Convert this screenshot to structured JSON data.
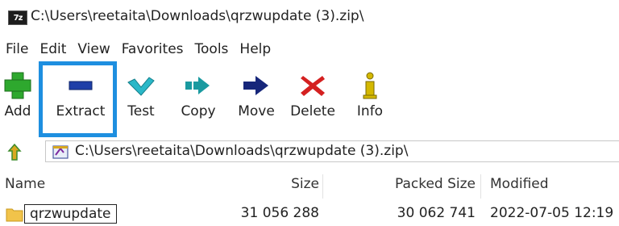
{
  "window": {
    "app_icon_text": "7z",
    "title": "C:\\Users\\reetaita\\Downloads\\qrzwupdate (3).zip\\"
  },
  "menu": [
    "File",
    "Edit",
    "View",
    "Favorites",
    "Tools",
    "Help"
  ],
  "toolbar": [
    {
      "label": "Add",
      "icon": "plus-icon",
      "color": "#2ea82e"
    },
    {
      "label": "Extract",
      "icon": "minus-icon",
      "color": "#1f3fa8"
    },
    {
      "label": "Test",
      "icon": "check-icon",
      "color": "#2ab8c8"
    },
    {
      "label": "Copy",
      "icon": "double-arrow-icon",
      "color": "#1a9aa0"
    },
    {
      "label": "Move",
      "icon": "arrow-right-icon",
      "color": "#16267a"
    },
    {
      "label": "Delete",
      "icon": "x-icon",
      "color": "#d42020"
    },
    {
      "label": "Info",
      "icon": "info-icon",
      "color": "#d4b800"
    }
  ],
  "address": {
    "path": "C:\\Users\\reetaita\\Downloads\\qrzwupdate (3).zip\\"
  },
  "columns": {
    "name": "Name",
    "size": "Size",
    "packed": "Packed Size",
    "modified": "Modified"
  },
  "rows": [
    {
      "name": "qrzwupdate",
      "size": "31 056 288",
      "packed": "30 062 741",
      "modified": "2022-07-05 12:19"
    }
  ],
  "colors": {
    "highlight": "#1e8fe0",
    "folder": "#f1c34a"
  }
}
